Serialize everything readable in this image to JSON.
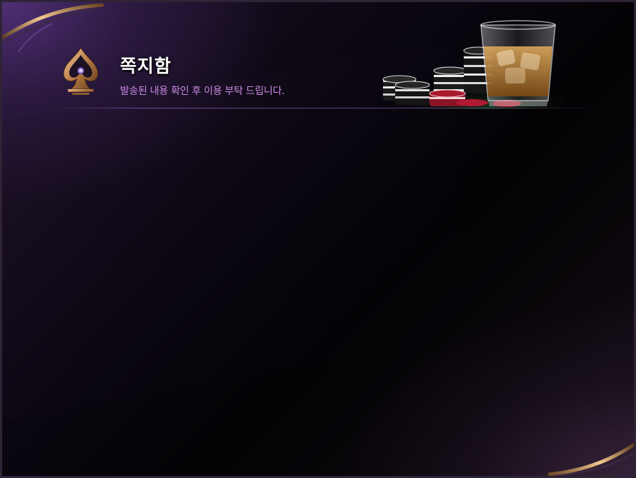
{
  "header": {
    "title": "쪽지함",
    "subtitle": "발송된 내용 확인 후 이용 부탁 드립니다."
  },
  "icons": {
    "emblem": "spade-icon",
    "decoration": "poker-chips-whiskey-icon"
  },
  "colors": {
    "title": "#ffffff",
    "subtitle": "#c88be0",
    "accent_purple": "#5a3482",
    "gold": "#d9a56a"
  }
}
